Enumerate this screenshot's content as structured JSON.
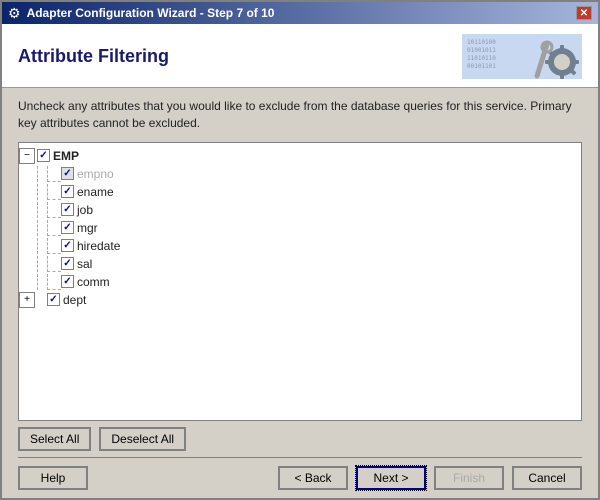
{
  "window": {
    "title": "Adapter Configuration Wizard - Step 7 of 10",
    "close_label": "✕"
  },
  "header": {
    "title": "Attribute Filtering"
  },
  "description": {
    "text": "Uncheck any attributes that you would like to exclude from the database queries for this service.  Primary key attributes cannot be excluded."
  },
  "tree": {
    "root": {
      "label": "EMP",
      "checked": true,
      "expanded": true,
      "children": [
        {
          "label": "empno",
          "checked": true,
          "disabled": true
        },
        {
          "label": "ename",
          "checked": true,
          "disabled": false
        },
        {
          "label": "job",
          "checked": true,
          "disabled": false
        },
        {
          "label": "mgr",
          "checked": true,
          "disabled": false
        },
        {
          "label": "hiredate",
          "checked": true,
          "disabled": false
        },
        {
          "label": "sal",
          "checked": true,
          "disabled": false
        },
        {
          "label": "comm",
          "checked": true,
          "disabled": false
        }
      ]
    },
    "dept_node": {
      "label": "dept",
      "checked": true,
      "collapsed": true
    }
  },
  "buttons": {
    "select_all": "Select All",
    "deselect_all": "Deselect All",
    "help": "Help",
    "back": "< Back",
    "next": "Next >",
    "finish": "Finish",
    "cancel": "Cancel"
  }
}
